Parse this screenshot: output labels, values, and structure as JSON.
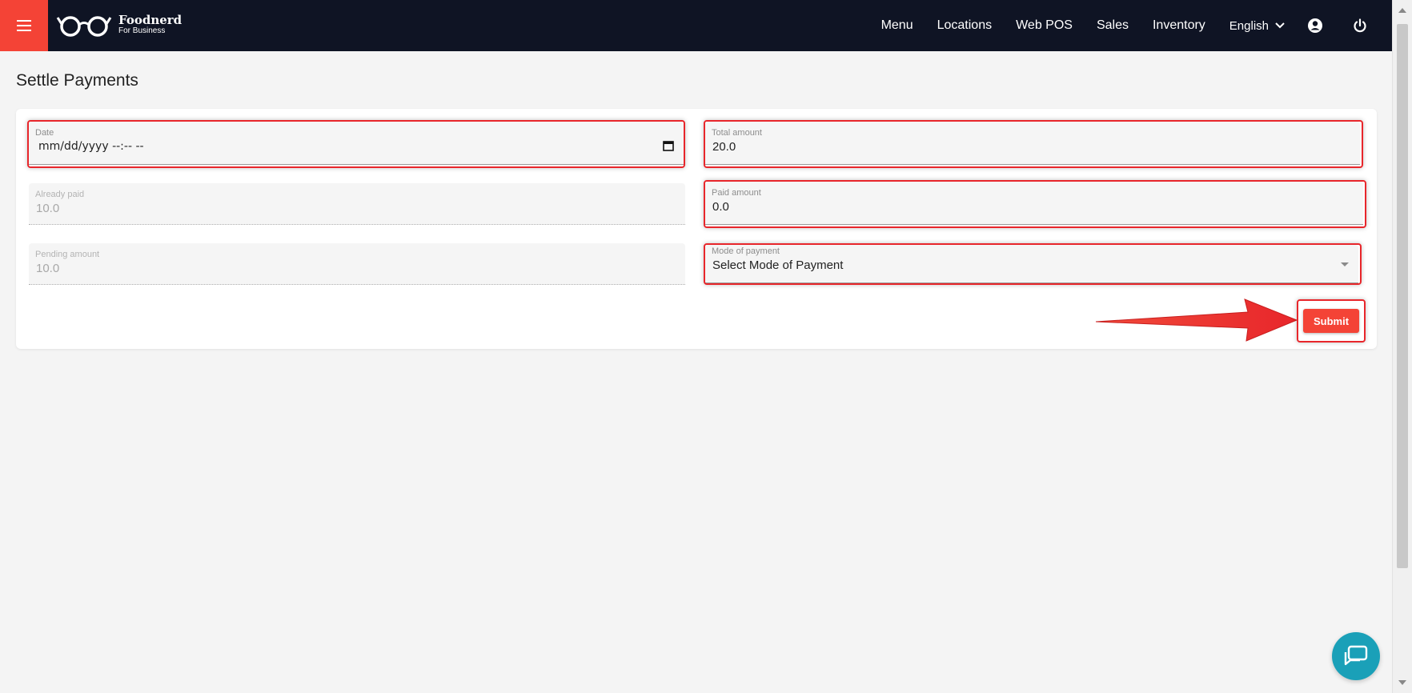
{
  "brand": {
    "name": "Foodnerd",
    "tagline": "For Business",
    "accent": "#f44336",
    "nav_bg": "#0f1424"
  },
  "nav": {
    "links": [
      "Menu",
      "Locations",
      "Web POS",
      "Sales",
      "Inventory"
    ],
    "language": "English",
    "icons": [
      "account-circle-icon",
      "power-icon"
    ]
  },
  "page": {
    "title": "Settle Payments"
  },
  "form": {
    "date": {
      "label": "Date",
      "value": "mm/dd/yyyy --:-- --"
    },
    "total_amount": {
      "label": "Total amount",
      "value": "20.0"
    },
    "already_paid": {
      "label": "Already paid",
      "value": "10.0"
    },
    "paid_amount": {
      "label": "Paid amount",
      "value": "0.0"
    },
    "pending_amount": {
      "label": "Pending amount",
      "value": "10.0"
    },
    "mode_of_payment": {
      "label": "Mode of payment",
      "value": "Select Mode of Payment"
    },
    "submit_label": "Submit"
  },
  "annotation_color": "#e8262b",
  "chat": {
    "icon": "chat-bubble-icon",
    "color": "#1aa0b8"
  }
}
